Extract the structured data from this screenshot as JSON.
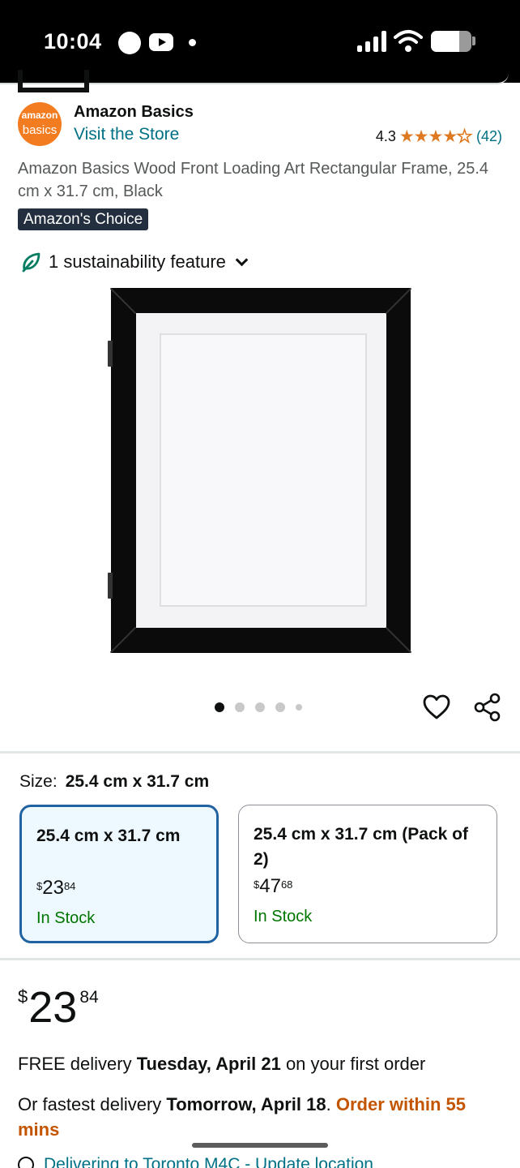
{
  "status_bar": {
    "time": "10:04",
    "battery_level": 0.7
  },
  "brand": {
    "logo_line1": "amazon",
    "logo_line2": "basics",
    "name": "Amazon Basics",
    "store_link": "Visit the Store"
  },
  "rating": {
    "value": "4.3",
    "stars": "★★★★",
    "half_star": "★",
    "count": "(42)",
    "stars_value": 4.3
  },
  "product": {
    "title": "Amazon Basics Wood Front Loading Art Rectangular Frame, 25.4 cm x 31.7 cm, Black",
    "badge": "Amazon's Choice",
    "sustainability": "1 sustainability feature",
    "image_count": 5,
    "active_image": 1
  },
  "size": {
    "label": "Size:",
    "selected_value": "25.4 cm x 31.7 cm",
    "options": [
      {
        "name": "25.4 cm x 31.7 cm",
        "currency": "$",
        "whole": "23",
        "fraction": "84",
        "stock": "In Stock",
        "selected": true
      },
      {
        "name": "25.4 cm x 31.7 cm (Pack of 2)",
        "currency": "$",
        "whole": "47",
        "fraction": "68",
        "stock": "In Stock",
        "selected": false
      }
    ]
  },
  "price": {
    "currency": "$",
    "whole": "23",
    "fraction": "84"
  },
  "delivery": {
    "prefix": "FREE delivery ",
    "date": "Tuesday, April 21",
    "suffix": " on your first order"
  },
  "fastest": {
    "prefix": "Or fastest delivery ",
    "date": "Tomorrow, April 18",
    "separator": ". ",
    "cutoff": "Order within 55 mins"
  },
  "location": {
    "text": "Delivering to Toronto M4C - Update location"
  },
  "colors": {
    "link": "#007185",
    "star": "#de7921",
    "in_stock": "#007600",
    "selected_border": "#2162a1",
    "urgent": "#c45500",
    "badge_bg": "#232f3e"
  }
}
